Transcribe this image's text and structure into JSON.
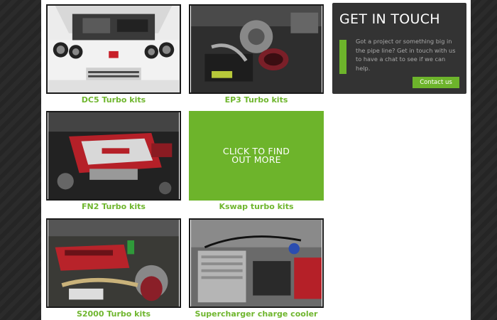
{
  "cards": [
    {
      "caption": "DC5 Turbo kits",
      "image": "honda-dc5-engine-bay-photo"
    },
    {
      "caption": "EP3 Turbo kits",
      "image": "ep3-turbo-intake-photo"
    },
    {
      "caption": "FN2 Turbo kits",
      "image": "fn2-vtec-engine-photo"
    },
    {
      "caption": "Kswap turbo kits",
      "image": "cta-tile"
    },
    {
      "caption": "S2000 Turbo kits",
      "image": "s2000-engine-bay-photo"
    },
    {
      "caption": "Supercharger charge cooler kits",
      "image": "supercharger-cooler-photo"
    }
  ],
  "cta": {
    "line1": "CLICK TO FIND",
    "line2": "OUT MORE"
  },
  "contact": {
    "title": "GET IN TOUCH",
    "text": "Got a project or something big in the pipe line? Get in touch with us to have a chat to see if we can help.",
    "button": "Contact us"
  },
  "colors": {
    "accent": "#6db42b",
    "panel": "#333333",
    "background": "#2a2a2a"
  }
}
